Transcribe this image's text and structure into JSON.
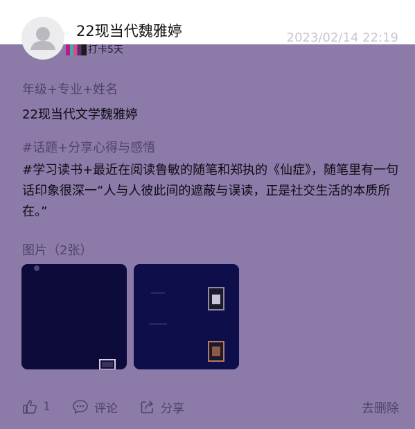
{
  "post": {
    "author": "22现当代魏雅婷",
    "time": "2023/02/14 22:19",
    "checkin_text": "打卡5天",
    "field1_label": "年级+专业+姓名",
    "field1_value": "22现当代文学魏雅婷",
    "field2_label": "#话题+分享心得与感悟",
    "field2_value": "#学习读书+最近在阅读鲁敏的随笔和郑执的《仙症》，随笔里有一句话印象很深一“人与人彼此间的遮蔽与误读，正是社交生活的本质所在。”",
    "images_label": "图片（2张）"
  },
  "actions": {
    "like_count": "1",
    "comment_label": "评论",
    "share_label": "分享",
    "delete_label": "去删除"
  },
  "icons": [
    "avatar-placeholder",
    "thumbs-up-icon",
    "comment-icon",
    "share-icon"
  ],
  "colors": {
    "overlay": "#8c7ba8",
    "header_bg": "#ffffff",
    "text": "#0d0b14",
    "muted_label": "#4f4368",
    "thumb_bg": "#0d0b3b"
  }
}
